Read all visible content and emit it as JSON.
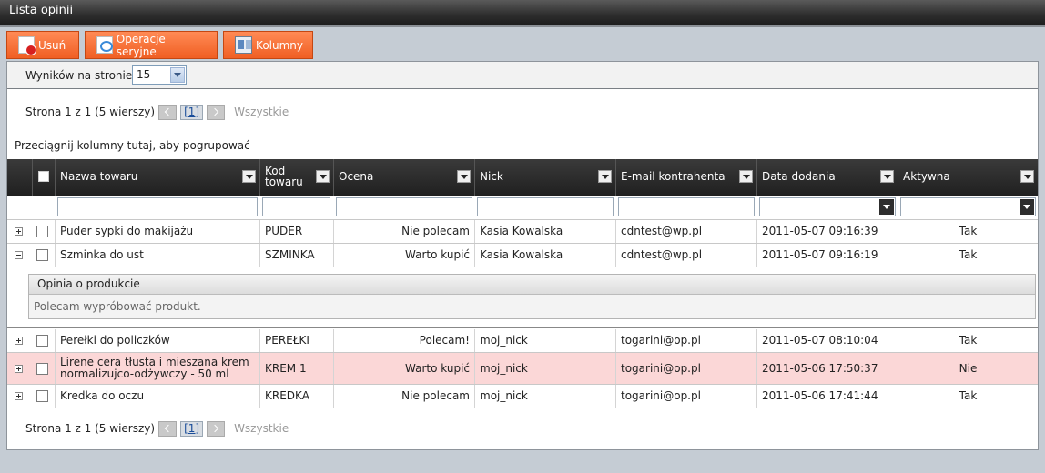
{
  "window": {
    "title": "Lista opinii"
  },
  "toolbar": {
    "delete_label": "Usuń",
    "batch_label": "Operacje seryjne",
    "columns_label": "Kolumny"
  },
  "perpage": {
    "label": "Wyników na stronie:",
    "value": "15"
  },
  "pager": {
    "info": "Strona 1 z 1 (5 wierszy)",
    "current": "[1]",
    "all": "Wszystkie"
  },
  "group_hint": "Przeciągnij kolumny tutaj, aby pogrupować",
  "columns": {
    "name": "Nazwa towaru",
    "code_line1": "Kod",
    "code_line2": "towaru",
    "rating": "Ocena",
    "nick": "Nick",
    "email": "E-mail kontrahenta",
    "date": "Data dodania",
    "active": "Aktywna"
  },
  "rows": [
    {
      "name": "Puder sypki do makijażu",
      "code": "PUDER",
      "rating": "Nie polecam",
      "nick": "Kasia Kowalska",
      "email": "cdntest@wp.pl",
      "date": "2011-05-07 09:16:39",
      "active": "Tak"
    },
    {
      "name": "Szminka do ust",
      "code": "SZMINKA",
      "rating": "Warto kupić",
      "nick": "Kasia Kowalska",
      "email": "cdntest@wp.pl",
      "date": "2011-05-07 09:16:19",
      "active": "Tak"
    },
    {
      "name": "Perełki do policzków",
      "code": "PEREŁKI",
      "rating": "Polecam!",
      "nick": "moj_nick",
      "email": "togarini@op.pl",
      "date": "2011-05-07 08:10:04",
      "active": "Tak"
    },
    {
      "name_line1": "Lirene cera tłusta i mieszana krem",
      "name_line2": "normalizujco-odżywczy - 50 ml",
      "code": "KREM 1",
      "rating": "Warto kupić",
      "nick": "moj_nick",
      "email": "togarini@op.pl",
      "date": "2011-05-06 17:50:37",
      "active": "Nie"
    },
    {
      "name": "Kredka do oczu",
      "code": "KREDKA",
      "rating": "Nie polecam",
      "nick": "moj_nick",
      "email": "togarini@op.pl",
      "date": "2011-05-06 17:41:44",
      "active": "Tak"
    }
  ],
  "detail": {
    "title": "Opinia o produkcie",
    "text": "Polecam wypróbować produkt."
  }
}
